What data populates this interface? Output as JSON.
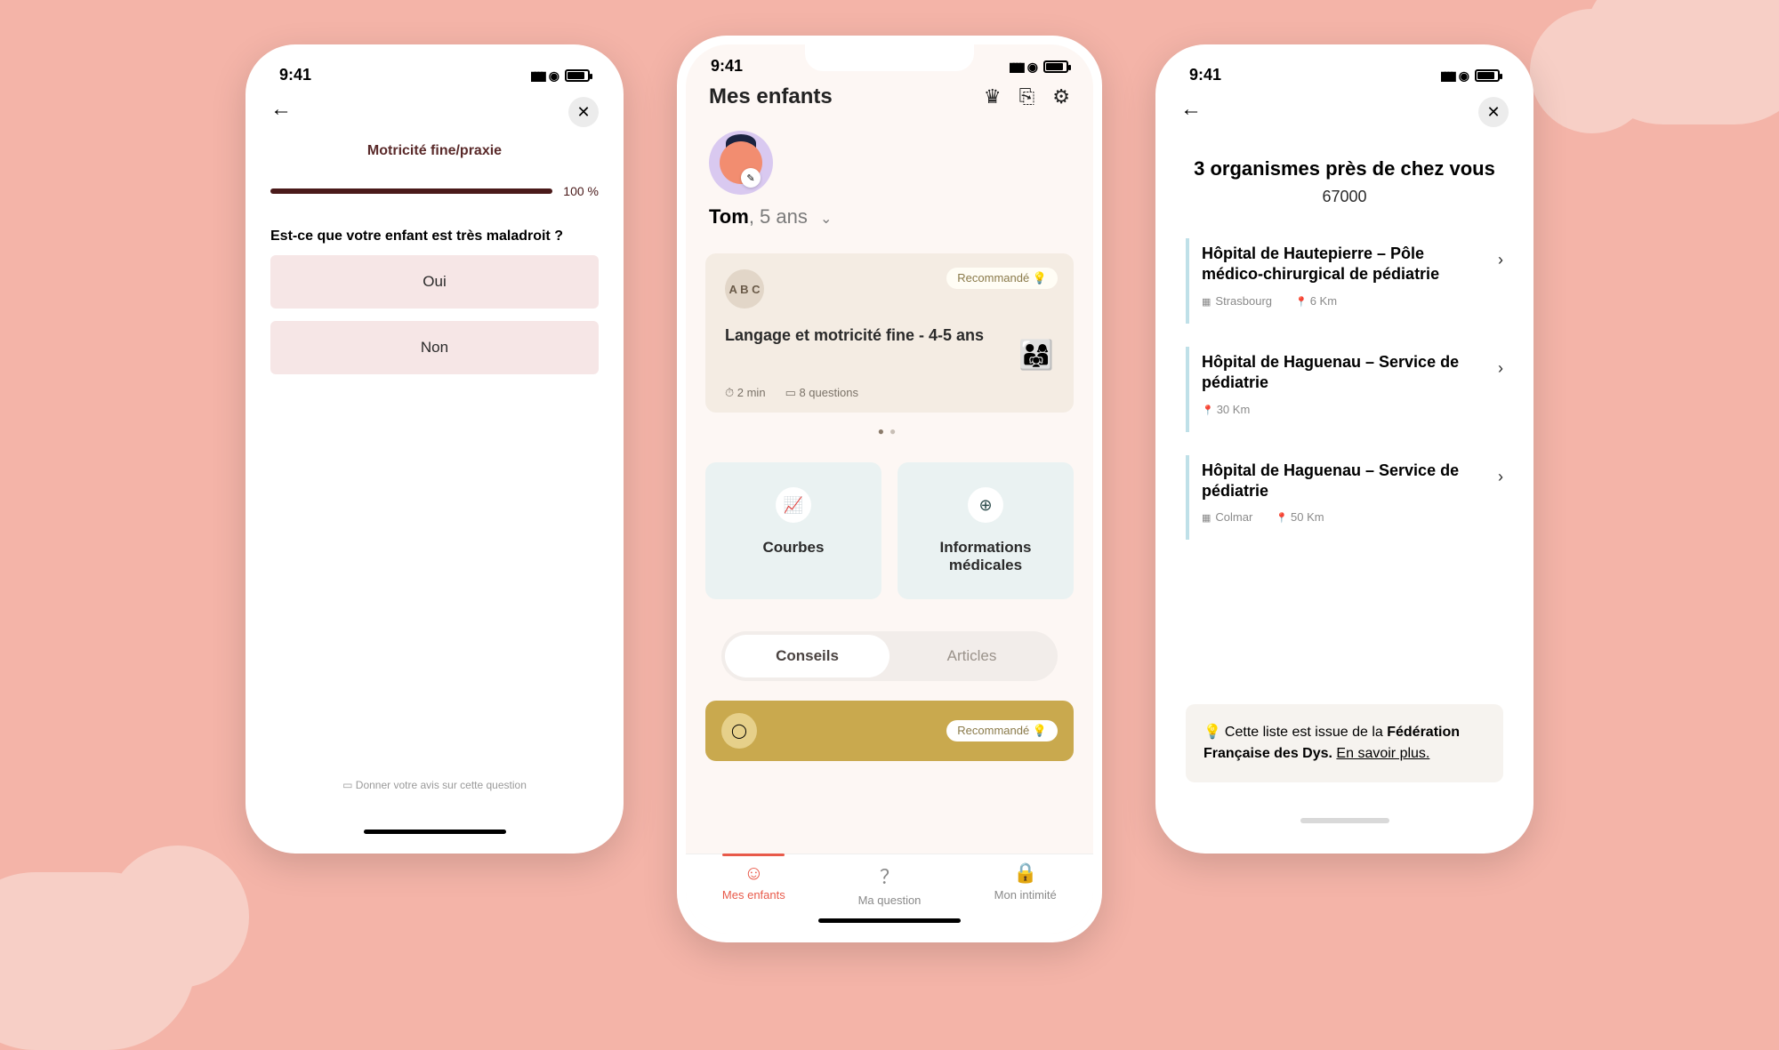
{
  "statusbar": {
    "time": "9:41"
  },
  "screen1": {
    "title": "Motricité fine/praxie",
    "progress_pct": "100 %",
    "question": "Est-ce que votre enfant est très maladroit ?",
    "answers": {
      "yes": "Oui",
      "no": "Non"
    },
    "feedback": "Donner votre avis sur cette question"
  },
  "screen2": {
    "header_title": "Mes enfants",
    "child_name": "Tom",
    "child_age": ", 5 ans",
    "card": {
      "badge": "Recommandé 💡",
      "icon_text": "A B C",
      "title": "Langage et motricité fine - 4-5 ans",
      "duration": "2 min",
      "questions": "8 questions"
    },
    "tiles": {
      "curves": "Courbes",
      "medical": "Informations médicales"
    },
    "segments": {
      "conseils": "Conseils",
      "articles": "Articles"
    },
    "card2_badge": "Recommandé 💡",
    "tabs": {
      "children": "Mes enfants",
      "question": "Ma question",
      "privacy": "Mon intimité"
    }
  },
  "screen3": {
    "title": "3 organismes près de chez vous",
    "postcode": "67000",
    "orgs": [
      {
        "name": "Hôpital de Hautepierre – Pôle médico-chirurgical de pédiatrie",
        "city": "Strasbourg",
        "dist": "6 Km"
      },
      {
        "name": "Hôpital de Haguenau – Service de pédiatrie",
        "city": "",
        "dist": "30 Km"
      },
      {
        "name": "Hôpital de Haguenau – Service de pédiatrie",
        "city": "Colmar",
        "dist": "50 Km"
      }
    ],
    "footer_pre": "Cette liste est issue de la ",
    "footer_bold": "Fédération Française des Dys. ",
    "footer_link": "En savoir plus."
  }
}
